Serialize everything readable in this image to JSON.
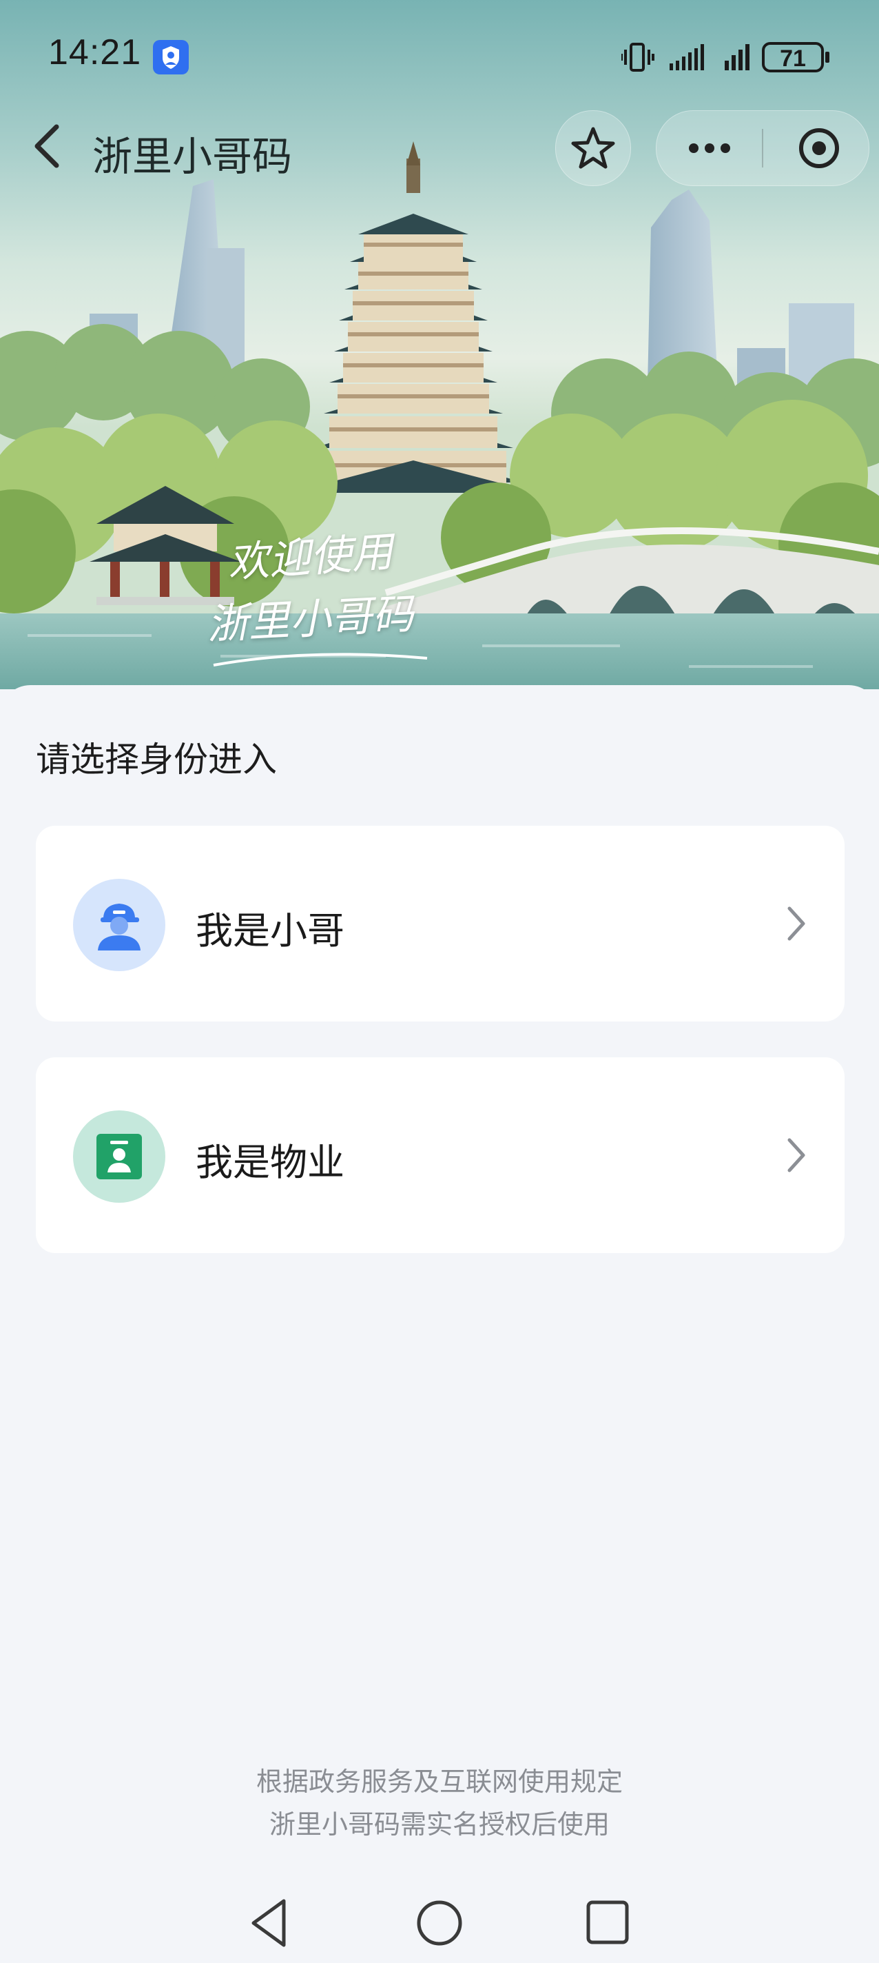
{
  "status_bar": {
    "time": "14:21",
    "battery": "71"
  },
  "nav": {
    "title": "浙里小哥码"
  },
  "hero": {
    "welcome_line1": "欢迎使用",
    "welcome_line2": "浙里小哥码"
  },
  "content": {
    "prompt": "请选择身份进入",
    "roles": [
      {
        "label": "我是小哥",
        "icon": "courier-icon",
        "icon_bg": "#d6e5fc",
        "icon_color": "#3b7bf0"
      },
      {
        "label": "我是物业",
        "icon": "property-badge-icon",
        "icon_bg": "#c5e8dc",
        "icon_color": "#21a268"
      }
    ],
    "footer_line1": "根据政务服务及互联网使用规定",
    "footer_line2": "浙里小哥码需实名授权后使用"
  }
}
